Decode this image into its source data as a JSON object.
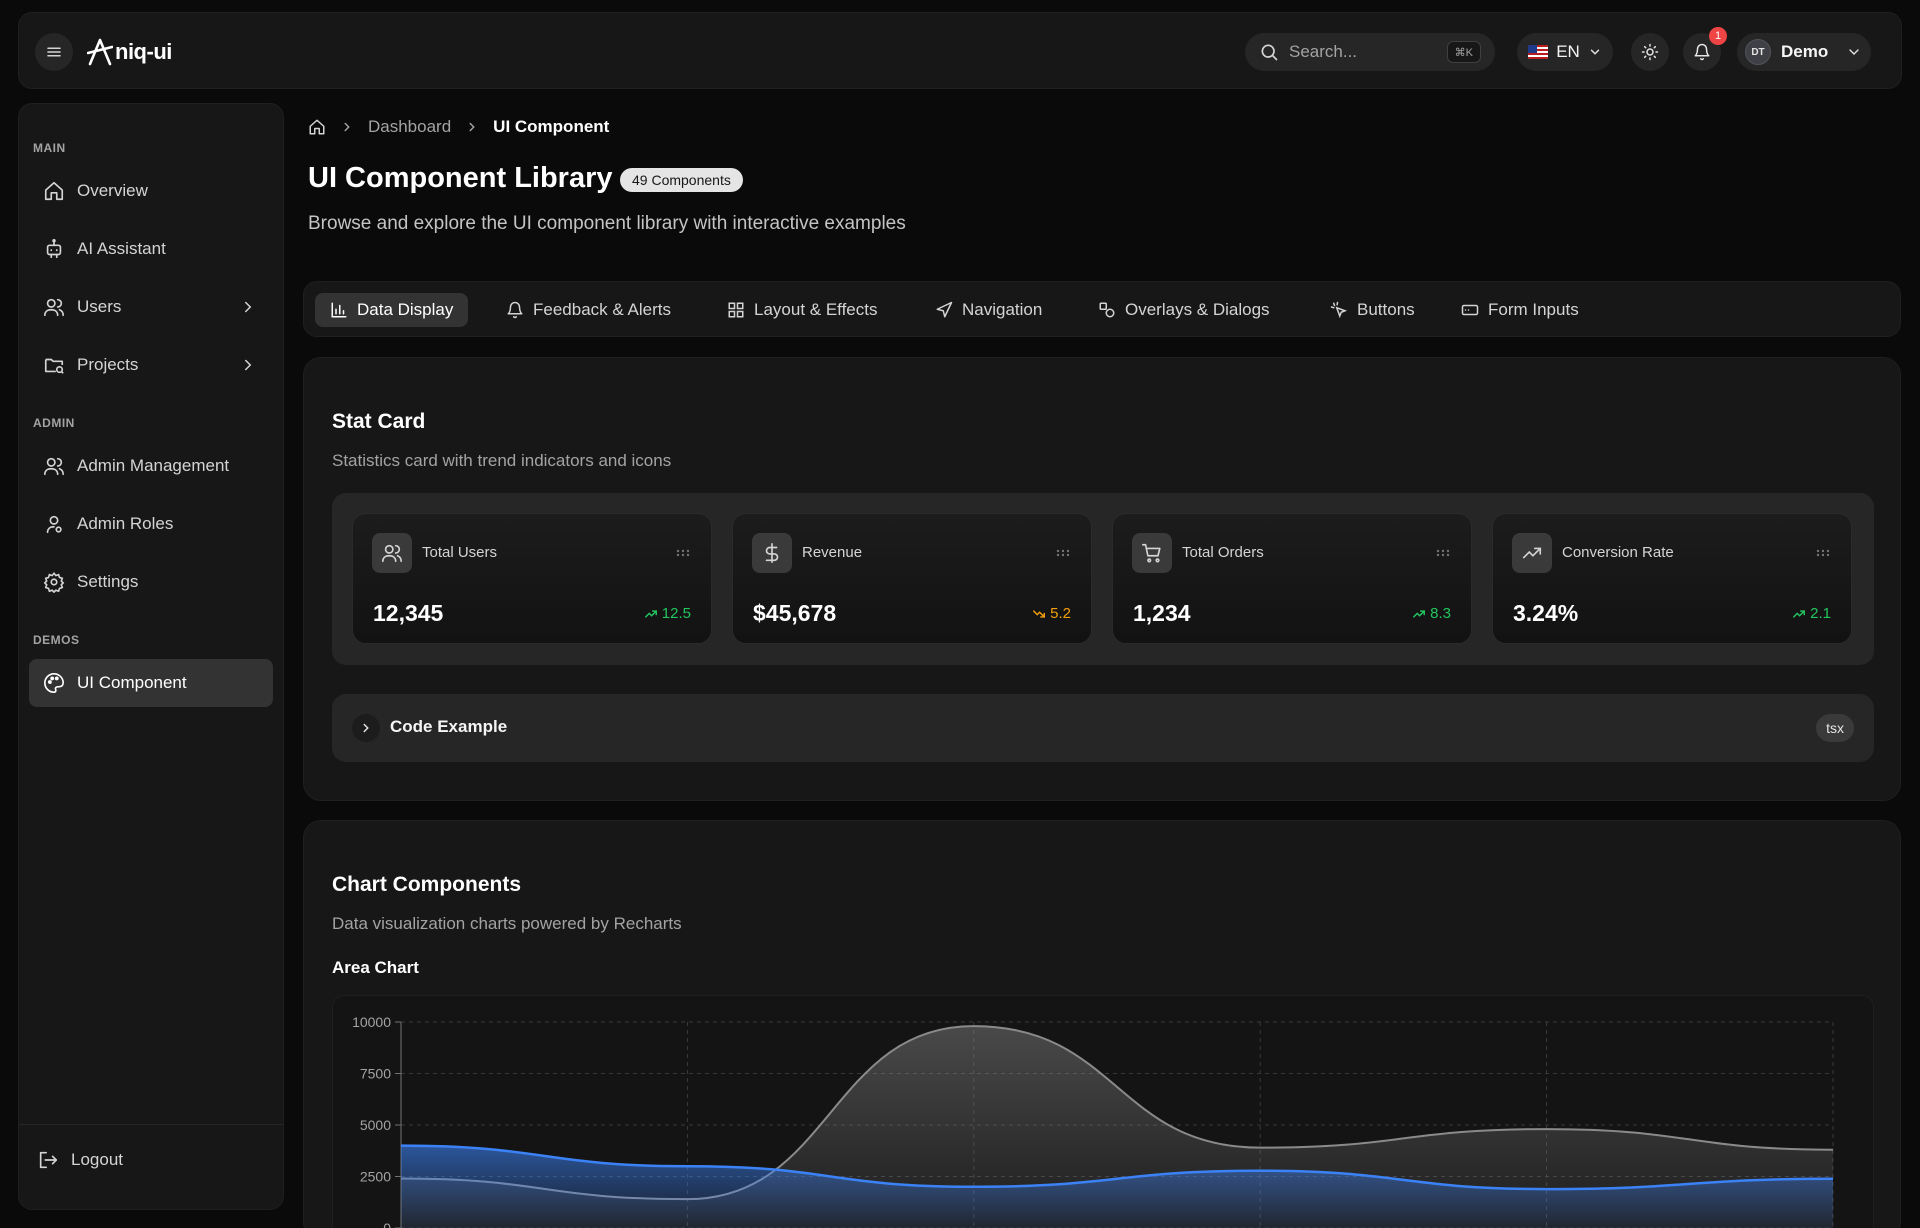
{
  "header": {
    "logo_text": "niq-ui",
    "search_placeholder": "Search...",
    "search_shortcut": "⌘K",
    "language": "EN",
    "notification_count": "1",
    "user_initials": "DT",
    "user_name": "Demo"
  },
  "sidebar": {
    "sections": {
      "main": "MAIN",
      "admin": "ADMIN",
      "demos": "DEMOS"
    },
    "items": {
      "overview": "Overview",
      "ai_assistant": "AI Assistant",
      "users": "Users",
      "projects": "Projects",
      "admin_management": "Admin Management",
      "admin_roles": "Admin Roles",
      "settings": "Settings",
      "ui_component": "UI Component"
    },
    "logout": "Logout"
  },
  "breadcrumb": {
    "dashboard": "Dashboard",
    "current": "UI Component"
  },
  "page": {
    "title": "UI Component Library",
    "badge": "49 Components",
    "subtitle": "Browse and explore the UI component library with interactive examples"
  },
  "tabs": [
    {
      "label": "Data Display",
      "icon": "bar-chart-icon",
      "active": true
    },
    {
      "label": "Feedback & Alerts",
      "icon": "bell-icon"
    },
    {
      "label": "Layout & Effects",
      "icon": "grid-icon"
    },
    {
      "label": "Navigation",
      "icon": "navigation-icon"
    },
    {
      "label": "Overlays & Dialogs",
      "icon": "shapes-icon"
    },
    {
      "label": "Buttons",
      "icon": "pointer-icon"
    },
    {
      "label": "Form Inputs",
      "icon": "input-icon"
    }
  ],
  "stat_card_section": {
    "title": "Stat Card",
    "description": "Statistics card with trend indicators and icons",
    "cards": [
      {
        "label": "Total Users",
        "value": "12,345",
        "trend": "12.5",
        "direction": "up",
        "icon": "users-icon"
      },
      {
        "label": "Revenue",
        "value": "$45,678",
        "trend": "5.2",
        "direction": "down",
        "icon": "dollar-icon"
      },
      {
        "label": "Total Orders",
        "value": "1,234",
        "trend": "8.3",
        "direction": "up",
        "icon": "cart-icon"
      },
      {
        "label": "Conversion Rate",
        "value": "3.24%",
        "trend": "2.1",
        "direction": "up",
        "icon": "trending-up-icon"
      }
    ],
    "code_example_label": "Code Example",
    "code_language": "tsx"
  },
  "chart_section": {
    "title": "Chart Components",
    "description": "Data visualization charts powered by Recharts",
    "area_chart_label": "Area Chart"
  },
  "colors": {
    "background": "#0a0a0a",
    "panel": "#171717",
    "trend_up": "#22c55e",
    "trend_down": "#f59e0b",
    "series_blue": "#3b82f6",
    "series_gray": "#8a8a8a",
    "badge": "#ef4444"
  },
  "chart_data": {
    "type": "area",
    "y_ticks": [
      "10000",
      "7500",
      "5000",
      "2500",
      "0"
    ],
    "ylim": [
      0,
      10000
    ],
    "x_points": 6,
    "grid": true,
    "series": [
      {
        "values": [
          2400,
          1400,
          9800,
          3900,
          4800,
          3800
        ],
        "color": "#8a8a8a"
      },
      {
        "values": [
          4000,
          3000,
          2000,
          2780,
          1890,
          2390
        ],
        "color": "#3b82f6"
      }
    ]
  }
}
